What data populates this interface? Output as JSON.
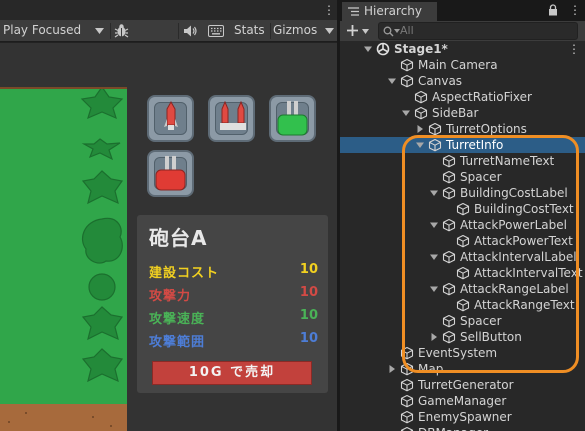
{
  "game_view": {
    "toolbar": {
      "display_mode": "Play Focused",
      "stats_label": "Stats",
      "gizmos_label": "Gizmos"
    },
    "turret_info": {
      "title": "砲台A",
      "rows": [
        {
          "label": "建設コスト",
          "value": "10",
          "color": "#f1d020"
        },
        {
          "label": "攻撃力",
          "value": "10",
          "color": "#d24a45"
        },
        {
          "label": "攻撃速度",
          "value": "10",
          "color": "#4ab257"
        },
        {
          "label": "攻撃範囲",
          "value": "10",
          "color": "#4d7dd6"
        }
      ],
      "sell_button": "10G で売却"
    },
    "turret_buttons": [
      "turret-single-red",
      "turret-double-red",
      "turret-green",
      "turret-red-cannon"
    ]
  },
  "hierarchy": {
    "tab_title": "Hierarchy",
    "search_placeholder": "All",
    "items": [
      {
        "label": "Stage1*",
        "depth": 0,
        "expanded": true,
        "type": "scene"
      },
      {
        "label": "Main Camera",
        "depth": 1,
        "type": "object"
      },
      {
        "label": "Canvas",
        "depth": 1,
        "expanded": true,
        "type": "object"
      },
      {
        "label": "AspectRatioFixer",
        "depth": 2,
        "type": "object"
      },
      {
        "label": "SideBar",
        "depth": 2,
        "expanded": true,
        "type": "object"
      },
      {
        "label": "TurretOptions",
        "depth": 3,
        "collapsed": true,
        "type": "object"
      },
      {
        "label": "TurretInfo",
        "depth": 3,
        "expanded": true,
        "selected": true,
        "type": "object"
      },
      {
        "label": "TurretNameText",
        "depth": 4,
        "type": "object"
      },
      {
        "label": "Spacer",
        "depth": 4,
        "type": "object"
      },
      {
        "label": "BuildingCostLabel",
        "depth": 4,
        "expanded": true,
        "type": "object"
      },
      {
        "label": "BuildingCostText",
        "depth": 5,
        "type": "object"
      },
      {
        "label": "AttackPowerLabel",
        "depth": 4,
        "expanded": true,
        "type": "object"
      },
      {
        "label": "AttackPowerText",
        "depth": 5,
        "type": "object"
      },
      {
        "label": "AttackIntervalLabel",
        "depth": 4,
        "expanded": true,
        "type": "object"
      },
      {
        "label": "AttackIntervalText",
        "depth": 5,
        "type": "object"
      },
      {
        "label": "AttackRangeLabel",
        "depth": 4,
        "expanded": true,
        "type": "object"
      },
      {
        "label": "AttackRangeText",
        "depth": 5,
        "type": "object"
      },
      {
        "label": "Spacer",
        "depth": 4,
        "type": "object"
      },
      {
        "label": "SellButton",
        "depth": 4,
        "collapsed": true,
        "type": "object"
      },
      {
        "label": "EventSystem",
        "depth": 1,
        "type": "object"
      },
      {
        "label": "Map",
        "depth": 1,
        "collapsed": true,
        "type": "object"
      },
      {
        "label": "TurretGenerator",
        "depth": 1,
        "type": "object"
      },
      {
        "label": "GameManager",
        "depth": 1,
        "type": "object"
      },
      {
        "label": "EnemySpawner",
        "depth": 1,
        "type": "object"
      },
      {
        "label": "DBManager",
        "depth": 1,
        "type": "object"
      }
    ]
  },
  "colors": {
    "selection": "#2c5d87",
    "highlight_outline": "#ef8e24",
    "grass": "#30a64a",
    "dirt": "#a76a3c"
  }
}
